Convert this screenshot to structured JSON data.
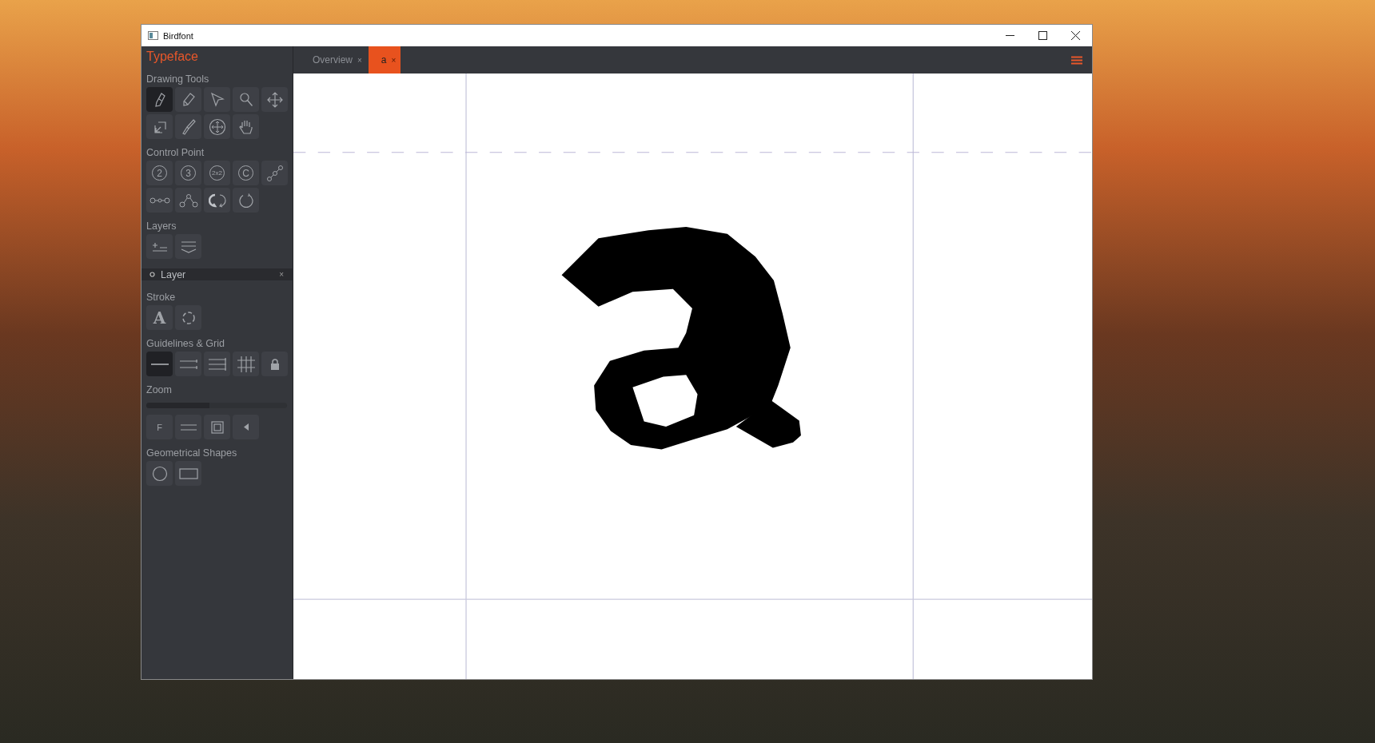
{
  "window": {
    "title": "Birdfont"
  },
  "sidebar": {
    "title": "Typeface",
    "sections": [
      {
        "heading": "Drawing Tools",
        "tools": [
          {
            "kind": "pen",
            "selected": true
          },
          {
            "kind": "pencil",
            "selected": false
          },
          {
            "kind": "pointer",
            "selected": false
          },
          {
            "kind": "magnifier",
            "selected": false
          },
          {
            "kind": "move",
            "selected": false
          },
          {
            "kind": "resize",
            "selected": false
          },
          {
            "kind": "brush",
            "selected": false
          },
          {
            "kind": "move-circle",
            "selected": false
          },
          {
            "kind": "hand",
            "selected": false
          }
        ]
      },
      {
        "heading": "Control Point",
        "tools": [
          {
            "kind": "numbered",
            "label": "2",
            "selected": false
          },
          {
            "kind": "numbered",
            "label": "3",
            "selected": false
          },
          {
            "kind": "numbered",
            "label": "2x2",
            "selected": false
          },
          {
            "kind": "numbered",
            "label": "C",
            "selected": false
          },
          {
            "kind": "nodes-diagonal",
            "selected": false
          },
          {
            "kind": "nodes-line",
            "selected": false
          },
          {
            "kind": "nodes-peak",
            "selected": false
          },
          {
            "kind": "rotate-arrows",
            "selected": false
          },
          {
            "kind": "circle-arrow",
            "selected": false
          }
        ]
      },
      {
        "heading": "Layers",
        "tools": [
          {
            "kind": "add-remove",
            "selected": false
          },
          {
            "kind": "layers",
            "selected": false
          }
        ],
        "layers": [
          {
            "name": "Layer",
            "close": "×"
          }
        ]
      },
      {
        "heading": "Stroke",
        "tools": [
          {
            "kind": "letter",
            "label": "A",
            "selected": false
          },
          {
            "kind": "dashed-circle",
            "selected": false
          }
        ]
      },
      {
        "heading": "Guidelines & Grid",
        "tools": [
          {
            "kind": "line-1",
            "selected": true
          },
          {
            "kind": "lines-2",
            "selected": false
          },
          {
            "kind": "lines-3",
            "selected": false
          },
          {
            "kind": "grid",
            "selected": false
          },
          {
            "kind": "lock",
            "selected": false
          }
        ]
      },
      {
        "heading": "Zoom",
        "slider": {
          "level": 0.45
        },
        "tools": [
          {
            "kind": "text",
            "label": "F",
            "selected": false
          },
          {
            "kind": "equal-lines",
            "selected": false
          },
          {
            "kind": "frame",
            "selected": false
          },
          {
            "kind": "triangle-left",
            "selected": false
          }
        ]
      },
      {
        "heading": "Geometrical Shapes",
        "tools": [
          {
            "kind": "circle",
            "selected": false
          },
          {
            "kind": "rectangle",
            "selected": false
          }
        ]
      }
    ]
  },
  "tabs": [
    {
      "label": "Overview",
      "close": "×",
      "selected": false
    },
    {
      "label": "a",
      "close": "×",
      "selected": true
    }
  ]
}
